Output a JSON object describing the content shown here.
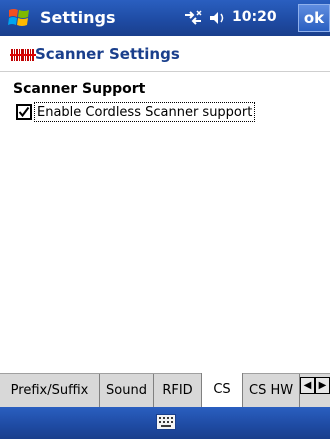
{
  "title_bar": {
    "title": "Settings",
    "time": "10:20",
    "ok_label": "ok",
    "icons": [
      "windows-logo-icon",
      "connectivity-icon",
      "volume-icon"
    ]
  },
  "header": {
    "icon": "scanner-barcode-icon",
    "page_title": "Scanner Settings"
  },
  "content": {
    "section_heading": "Scanner Support",
    "checkbox": {
      "label": "Enable Cordless Scanner support",
      "checked": true
    }
  },
  "tabs": [
    {
      "label": "Prefix/Suffix",
      "active": false
    },
    {
      "label": "Sound",
      "active": false
    },
    {
      "label": "RFID",
      "active": false
    },
    {
      "label": "CS",
      "active": true
    },
    {
      "label": "CS HW",
      "active": false
    }
  ],
  "tab_scroll": {
    "left_icon": "◀",
    "right_icon": "▶"
  },
  "menu_bar": {
    "icon": "keyboard-icon"
  },
  "colors": {
    "title_bar_blue": "#1e4aa2",
    "heading_blue": "#1a3f8c",
    "tab_gray": "#d8d8d8"
  }
}
